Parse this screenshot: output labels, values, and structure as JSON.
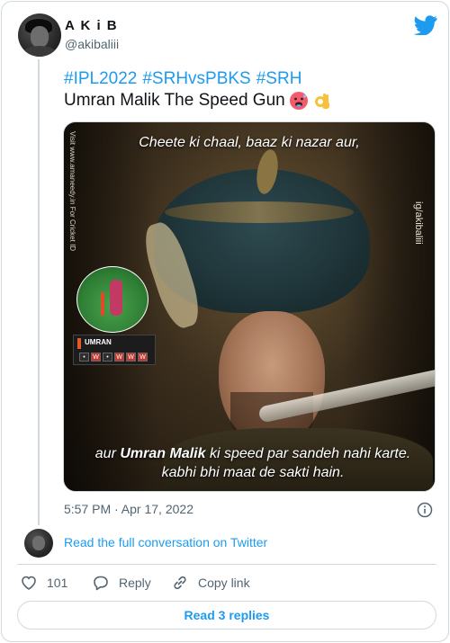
{
  "author": {
    "display_name": "A K i B",
    "handle": "@akibaliii"
  },
  "tweet": {
    "hashtags": [
      "#IPL2022",
      "#SRHvsPBKS",
      "#SRH"
    ],
    "text": "Umran Malik The Speed Gun",
    "emojis": [
      "hot-face-emoji",
      "ok-hand-emoji"
    ]
  },
  "media": {
    "caption_top": "Cheete ki chaal, baaz ki nazar aur,",
    "caption_bottom_pre": "aur ",
    "caption_bottom_bold": "Umran Malik",
    "caption_bottom_post": " ki speed par sandeh nahi karte. kabhi bhi maat de sakti hain.",
    "watermark_left": "Visit www.amaneedy.in For Cricket ID",
    "watermark_right": "ig/akibaliii",
    "scorebar_label": "UMRAN",
    "scorebar_balls": [
      "•",
      "W",
      "•",
      "W",
      "W",
      "W"
    ]
  },
  "meta": {
    "timestamp": "5:57 PM · Apr 17, 2022"
  },
  "conversation": {
    "link_text": "Read the full conversation on Twitter"
  },
  "actions": {
    "like_count": "101",
    "reply_label": "Reply",
    "copy_label": "Copy link",
    "read_replies_label": "Read 3 replies"
  },
  "colors": {
    "accent": "#1d9bf0",
    "text": "#0f1419",
    "secondary": "#536471",
    "border": "#cfd9de"
  }
}
